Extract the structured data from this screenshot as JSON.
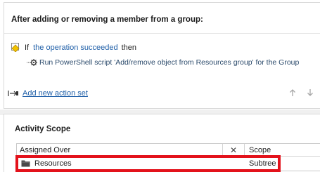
{
  "panel": {
    "title": "After adding or removing a member from a group:"
  },
  "condition": {
    "if_label": "If",
    "link_text": "the operation succeeded",
    "then_label": "then",
    "action_text": "Run PowerShell script 'Add/remove object from Resources group' for the Group"
  },
  "add_action": {
    "label": "Add new action set"
  },
  "activity_scope": {
    "heading": "Activity Scope",
    "columns": {
      "assigned_over": "Assigned Over",
      "remove": "✕",
      "scope": "Scope"
    },
    "rows": [
      {
        "name": "Resources",
        "scope": "Subtree"
      }
    ]
  },
  "colors": {
    "link": "#1f5fa8",
    "highlight": "#e3121b",
    "condition_icon": "#d9a400",
    "folder": "#4a4a4a"
  }
}
